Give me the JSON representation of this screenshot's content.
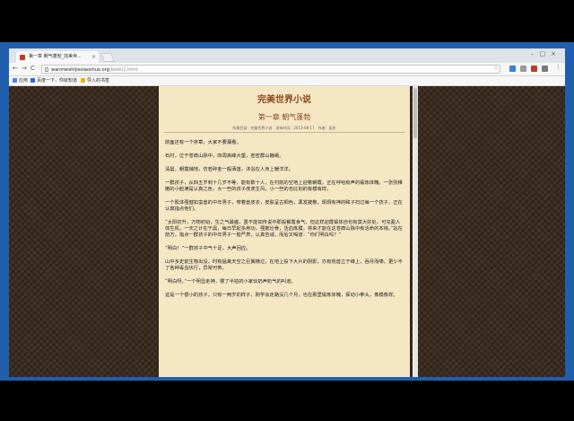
{
  "browser": {
    "tab_title": "第一章 朝气蓬勃_完美世...",
    "tab_close": "×",
    "window_controls": "–□×",
    "url_host": "wanmeishijiexiaoshuo.org",
    "url_path": "/book/1.html",
    "back": "←",
    "forward": "→",
    "reload": "C",
    "star": "☆",
    "menu": "⋮",
    "bookmarks": [
      {
        "label": "应用",
        "icon_color": "#4a86e8"
      },
      {
        "label": "百度一下，你就知道",
        "icon_color": "#2d6ad8"
      },
      {
        "label": "导入的书签",
        "icon_color": "#e6b800"
      }
    ]
  },
  "page": {
    "site_title": "完美世界小说",
    "chapter_title": "第一章 朝气蓬勃",
    "meta": "所属目录：完美世界小说　发布时间：2013-08-17　作者：辰东",
    "paragraphs": [
      "前面还有一个序章，大家不要漏看。",
      "石村，位于苍莽山脉中，四周高峰大壑，密密群山巍峨。",
      "清晨，朝霞铺地，仿若碎金一般洒落，沐浴在人身上暖洋洋。",
      "一群孩子，从四五岁到十几岁不等，能有数十人，在村前的空地上迎着朝霞，正在呼哈有声的锻炼体魄。一张张稚嫩的小脸满是认真之色，大一些的孩子虎虎生风，小一些的也比划的有模有样。",
      "一个肌体强健如蛮兽的中年男子，穿着兽皮衣，皮肤呈古铜色，黑发披散，炯炯有神的眸子扫过每一个孩子，正在认真指点他们。",
      "“太阳初升，万物初始，生之气最盛，虽不能如传说中那般餐霞食气，但这样迎霞锻体自也有莫大好处，可充盈人体生机。一天之计在于晨，每日早起多用功，强筋壮骨，活血炼膜，将来才能在这苍莽山脉中有活命的本钱。”站在前方，指点一群孩子的中年男子一脸严肃，认真告诫，而后又喝道：“你们明白吗？”",
      "“明白！”一群孩子中气十足，大声回应。",
      "山中多史前生物出没，时有猛禽天空之巨翼横过，在地上投下大片的阴影，亦有荒兽立于峰上，吞月而啸，更少不了各种毒虫伏行，异常可怖。",
      "“明白呀。”一个明显走神，慢了半拍的小家伙奶声奶气的叫道。",
      "这是一个很小的孩子，只有一两岁的样子，刚学会走路没几个月，也在那里锻炼体魄，挥动小拳头，像模像样。"
    ]
  }
}
